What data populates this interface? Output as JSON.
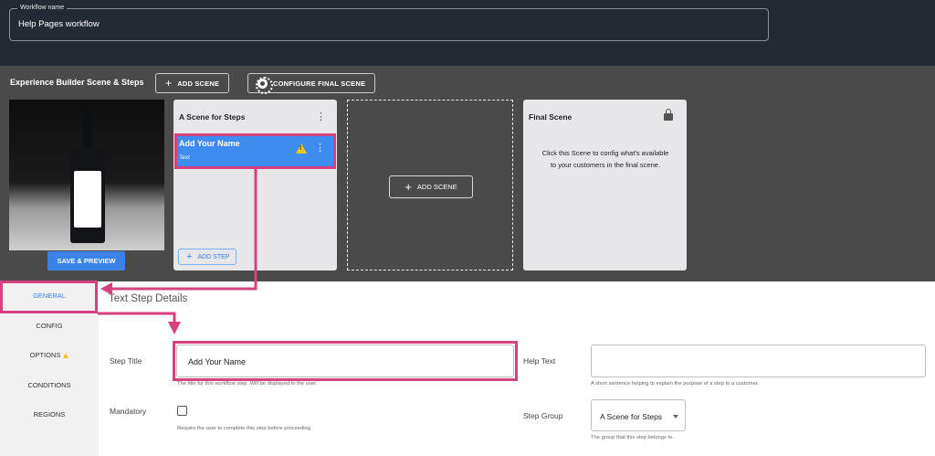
{
  "header": {
    "workflow_name_label": "Workflow name",
    "workflow_name_value": "Help Pages workflow"
  },
  "builder": {
    "title": "Experience Builder Scene & Steps",
    "add_scene_label": "ADD SCENE",
    "configure_final_scene_label": "CONFIGURE FINAL SCENE",
    "save_preview_label": "SAVE & PREVIEW",
    "scene_card": {
      "title": "A Scene for Steps",
      "step_name": "Add Your Name",
      "step_type": "Text",
      "add_step_label": "ADD STEP"
    },
    "new_scene_label": "ADD SCENE",
    "final_scene": {
      "title": "Final Scene",
      "description": "Click this Scene to config what's available to your customers in the final scene."
    }
  },
  "sidebar": {
    "items": [
      {
        "label": "GENERAL",
        "active": true
      },
      {
        "label": "CONFIG",
        "active": false
      },
      {
        "label": "OPTIONS",
        "active": false,
        "warning": true
      },
      {
        "label": "CONDITIONS",
        "active": false
      },
      {
        "label": "REGIONS",
        "active": false
      }
    ]
  },
  "details": {
    "heading": "Text Step Details",
    "step_title_label": "Step Title",
    "step_title_value": "Add Your Name",
    "step_title_helper": "The title for this workflow step. Will be displayed to the user.",
    "help_text_label": "Help Text",
    "help_text_value": "",
    "help_text_helper": "A short sentence helping to explain the purpose of a step to a customer.",
    "mandatory_label": "Mandatory",
    "mandatory_checked": false,
    "mandatory_helper": "Require the user to complete this step before proceeding",
    "step_group_label": "Step Group",
    "step_group_value": "A Scene for Steps",
    "step_group_helper": "The group that this step belongs to."
  },
  "colors": {
    "accent": "#3b82e6",
    "annotation": "#d6427f",
    "warning": "#f5c518",
    "header_bg": "#222a33",
    "band_bg": "#4a4a4a"
  }
}
